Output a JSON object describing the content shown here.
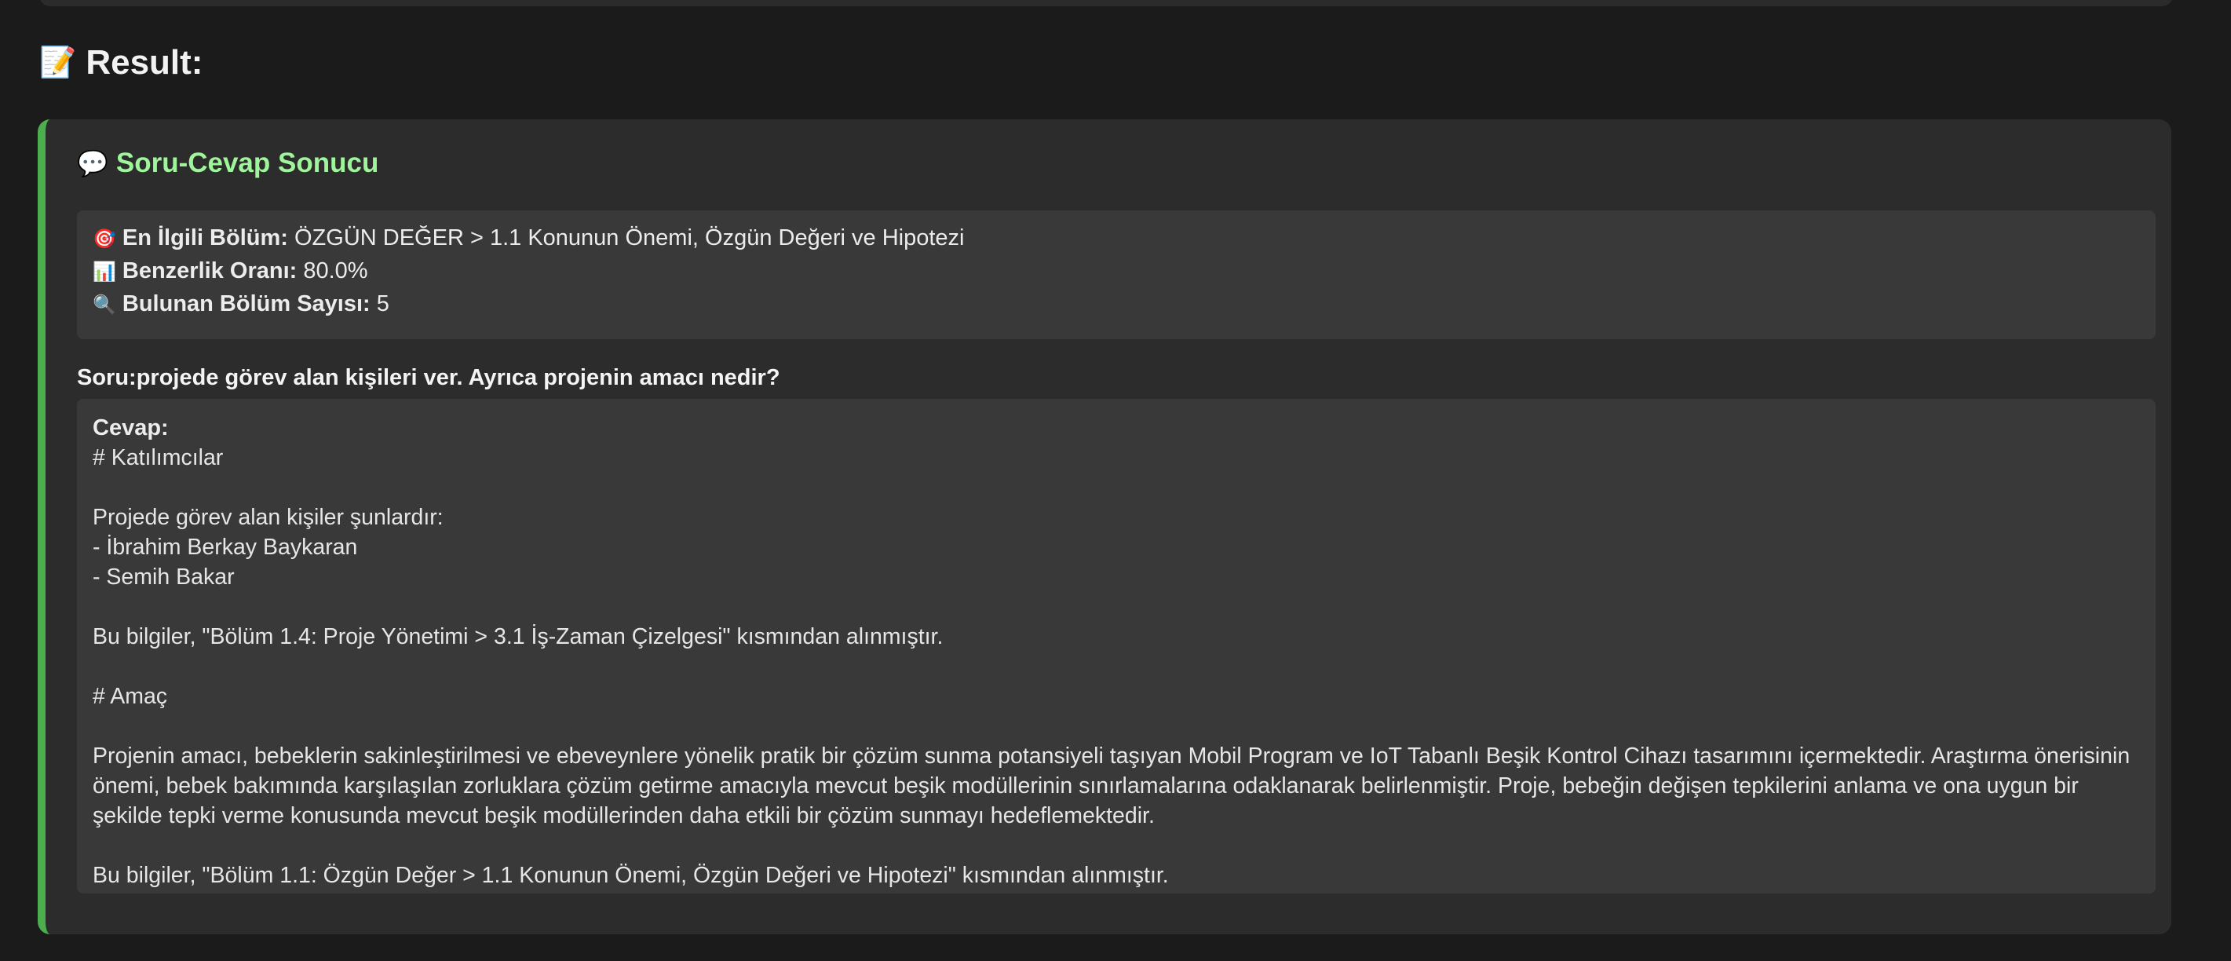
{
  "result_heading": {
    "icon": "memo-icon",
    "emoji": "📝",
    "text": "Result:"
  },
  "card": {
    "accent_color": "#4cae4c",
    "title_emoji": "💬",
    "title": "Soru-Cevap Sonucu",
    "info": [
      {
        "icon": "target-icon",
        "emoji": "🎯",
        "label": "En İlgili Bölüm:",
        "value": "ÖZGÜN DEĞER > 1.1 Konunun Önemi, Özgün Değeri ve Hipotezi"
      },
      {
        "icon": "bar-chart-icon",
        "emoji": "📊",
        "label": "Benzerlik Oranı:",
        "value": "80.0%"
      },
      {
        "icon": "magnifier-icon",
        "emoji": "🔍",
        "label": "Bulunan Bölüm Sayısı:",
        "value": "5"
      }
    ],
    "question": "Soru:projede görev alan kişileri ver. Ayrıca projenin amacı nedir?",
    "answer_label": "Cevap:",
    "answer_text": "# Katılımcılar\n\nProjede görev alan kişiler şunlardır:\n- İbrahim Berkay Baykaran\n- Semih Bakar\n\nBu bilgiler, \"Bölüm 1.4: Proje Yönetimi > 3.1 İş-Zaman Çizelgesi\" kısmından alınmıştır.\n\n# Amaç\n\nProjenin amacı, bebeklerin sakinleştirilmesi ve ebeveynlere yönelik pratik bir çözüm sunma potansiyeli taşıyan Mobil Program ve IoT Tabanlı Beşik Kontrol Cihazı tasarımını içermektedir. Araştırma önerisinin önemi, bebek bakımında karşılaşılan zorluklara çözüm getirme amacıyla mevcut beşik modüllerinin sınırlamalarına odaklanarak belirlenmiştir. Proje, bebeğin değişen tepkilerini anlama ve ona uygun bir şekilde tepki verme konusunda mevcut beşik modüllerinden daha etkili bir çözüm sunmayı hedeflemektedir.\n\nBu bilgiler, \"Bölüm 1.1: Özgün Değer > 1.1 Konunun Önemi, Özgün Değeri ve Hipotezi\" kısmından alınmıştır."
  }
}
